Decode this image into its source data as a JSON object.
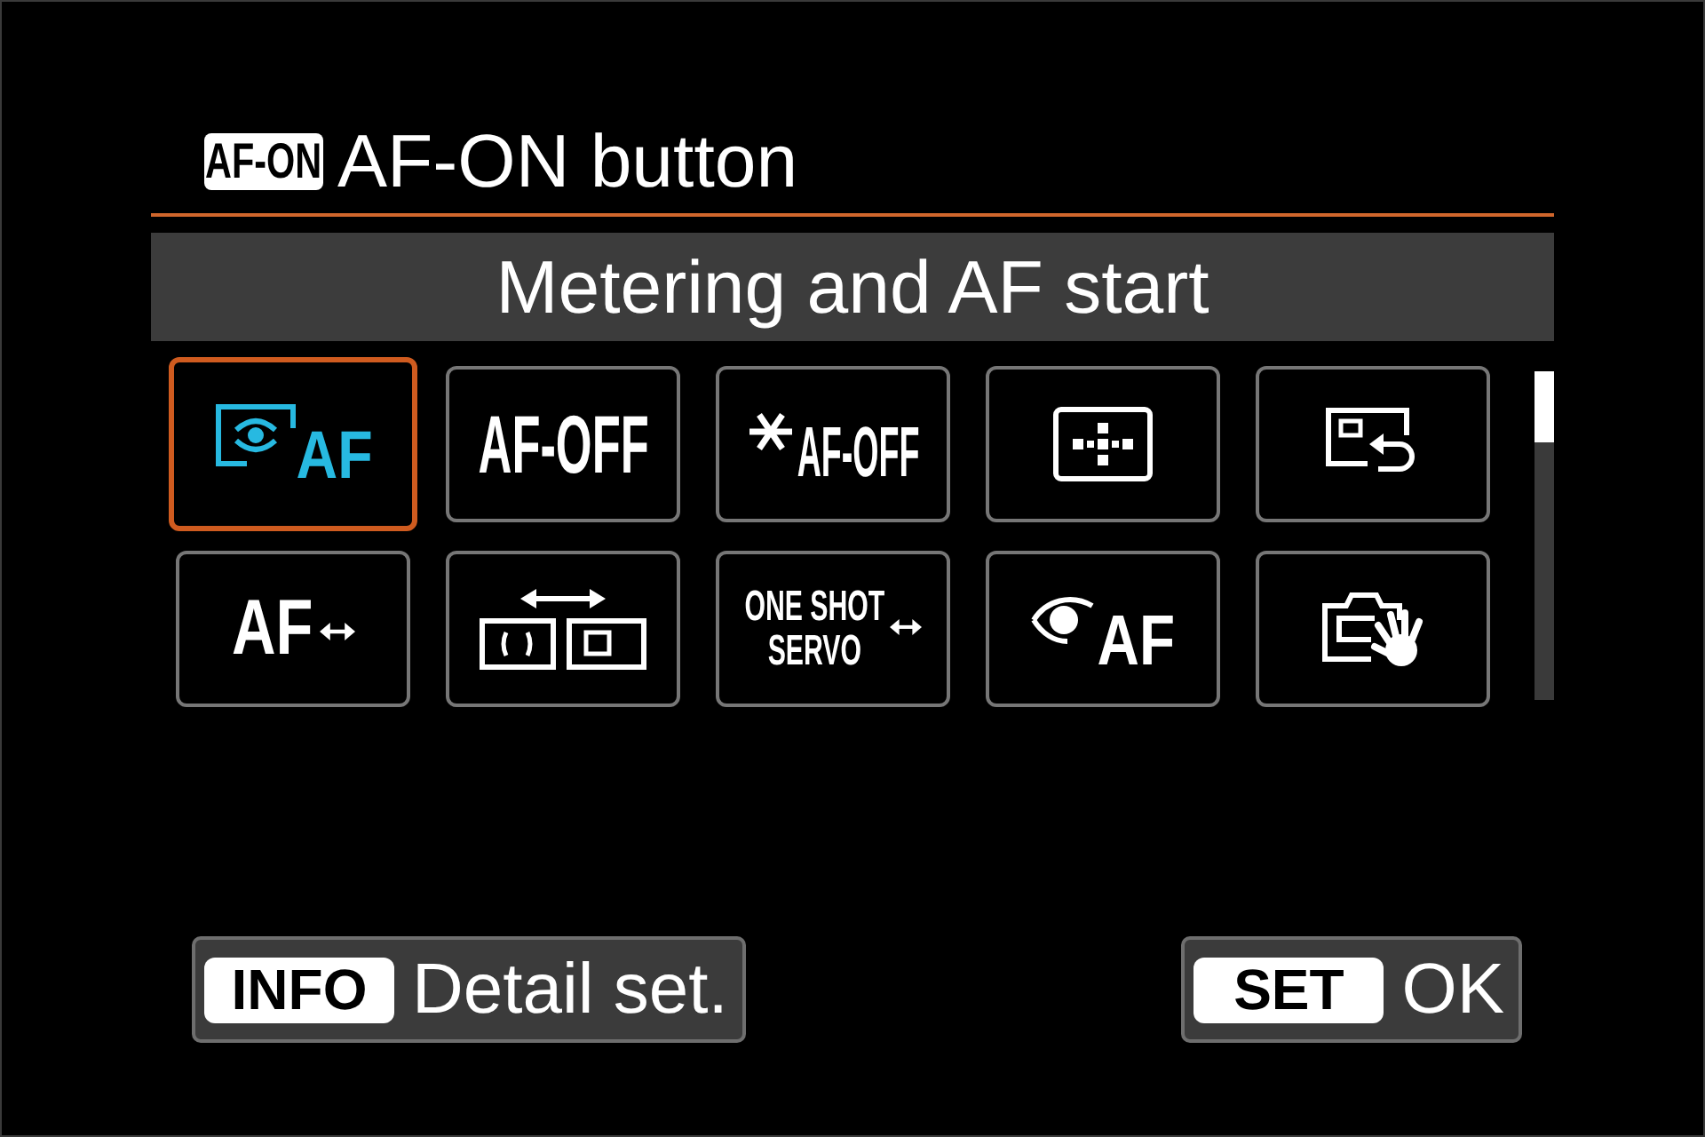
{
  "header": {
    "key": "AF-ON",
    "title": "AF-ON button"
  },
  "function_name": "Metering and AF start",
  "options": [
    {
      "kind": "metering-af",
      "text": "AF",
      "selected": true
    },
    {
      "kind": "text",
      "text": "AF-OFF",
      "selected": false
    },
    {
      "kind": "star-text",
      "text": "AF-OFF",
      "selected": false
    },
    {
      "kind": "af-point",
      "selected": false
    },
    {
      "kind": "register-recall",
      "selected": false
    },
    {
      "kind": "text-arrows",
      "text": "AF",
      "selected": false
    },
    {
      "kind": "area-switch",
      "selected": false
    },
    {
      "kind": "lines-arrows",
      "lines": [
        "ONE SHOT",
        "SERVO"
      ],
      "selected": false
    },
    {
      "kind": "eye-af",
      "text": "AF",
      "selected": false
    },
    {
      "kind": "camera-hand",
      "selected": false
    }
  ],
  "footer_buttons": [
    {
      "key": "INFO",
      "label": "Detail set."
    },
    {
      "key": "SET",
      "label": "OK"
    }
  ]
}
